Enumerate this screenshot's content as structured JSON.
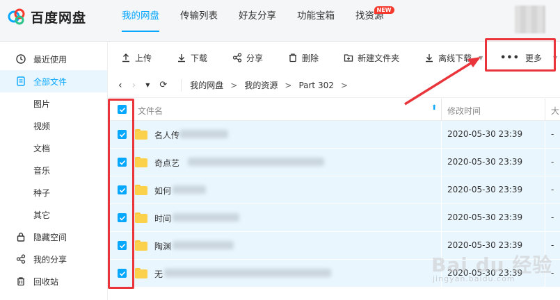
{
  "app": {
    "title": "百度网盘"
  },
  "nav": {
    "items": [
      {
        "label": "我的网盘"
      },
      {
        "label": "传输列表"
      },
      {
        "label": "好友分享"
      },
      {
        "label": "功能宝箱"
      },
      {
        "label": "找资源"
      }
    ],
    "new_badge": "NEW"
  },
  "sidebar": {
    "items": [
      {
        "label": "最近使用",
        "icon": "clock-icon"
      },
      {
        "label": "全部文件",
        "icon": "file-icon"
      },
      {
        "label": "图片"
      },
      {
        "label": "视频"
      },
      {
        "label": "文档"
      },
      {
        "label": "音乐"
      },
      {
        "label": "种子"
      },
      {
        "label": "其它"
      },
      {
        "label": "隐藏空间",
        "icon": "lock-icon"
      },
      {
        "label": "我的分享",
        "icon": "share-icon"
      },
      {
        "label": "回收站",
        "icon": "trash-icon"
      }
    ]
  },
  "toolbar": {
    "upload": "上传",
    "download": "下载",
    "share": "分享",
    "delete": "删除",
    "new_folder": "新建文件夹",
    "offline_download": "离线下载",
    "more": "更多"
  },
  "breadcrumb": {
    "items": [
      "我的网盘",
      "我的资源",
      "Part 302"
    ],
    "separator": ">"
  },
  "table": {
    "headers": {
      "name": "文件名",
      "modified": "修改时间",
      "size": "大"
    },
    "rows": [
      {
        "name": "名人传",
        "modified": "2020-05-30 23:39",
        "size": "-"
      },
      {
        "name": "奇点艺",
        "modified": "2020-05-30 23:39",
        "size": "-"
      },
      {
        "name": "如何",
        "modified": "2020-05-30 23:39",
        "size": "-"
      },
      {
        "name": "时间",
        "modified": "2020-05-30 23:39",
        "size": "-"
      },
      {
        "name": "陶渊",
        "modified": "2020-05-30 23:39",
        "size": "-"
      },
      {
        "name": "无",
        "modified": "2020-05-30 23:39",
        "size": "-"
      }
    ]
  },
  "colors": {
    "accent": "#06a7ff",
    "selected_row": "#eaf6fe",
    "annotation_red": "#e8343a"
  }
}
